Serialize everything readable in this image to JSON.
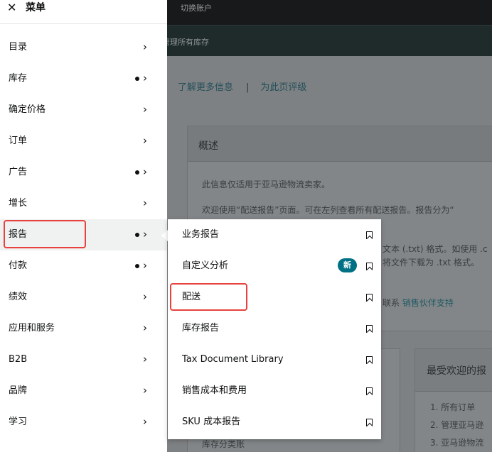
{
  "background": {
    "topbar_text": "切换账户",
    "subbar_text": "管理所有库存",
    "links": {
      "learn_more": "了解更多信息",
      "rate_page": "为此页评级"
    },
    "overview": {
      "title": "概述",
      "line1": "此信息仅适用于亚马逊物流卖家。",
      "line2": "欢迎使用“配送报告”页面。可在左列查看所有配送报告。报告分为“",
      "line3": "文本 (.txt) 格式。如使用 .c",
      "line4": "将文件下载为 .txt 格式。",
      "contact_prefix": "联系",
      "contact_link": "销售伙伴支持"
    },
    "popular": {
      "title": "最受欢迎的报",
      "items": [
        "1. 所有订单",
        "2. 管理亚马逊",
        "3. 亚马逊物流"
      ]
    },
    "inventory_ledger": "库存分类账"
  },
  "menu": {
    "title": "菜单",
    "close_icon": "close-icon",
    "items": [
      {
        "label": "目录",
        "dot": false
      },
      {
        "label": "库存",
        "dot": true
      },
      {
        "label": "确定价格",
        "dot": false
      },
      {
        "label": "订单",
        "dot": false
      },
      {
        "label": "广告",
        "dot": true
      },
      {
        "label": "增长",
        "dot": false
      },
      {
        "label": "报告",
        "dot": true,
        "active": true
      },
      {
        "label": "付款",
        "dot": true
      },
      {
        "label": "绩效",
        "dot": false
      },
      {
        "label": "应用和服务",
        "dot": false
      },
      {
        "label": "B2B",
        "dot": false
      },
      {
        "label": "品牌",
        "dot": false
      },
      {
        "label": "学习",
        "dot": false
      }
    ],
    "chevron": "›"
  },
  "submenu": {
    "items": [
      {
        "label": "业务报告"
      },
      {
        "label": "自定义分析",
        "badge": "新"
      },
      {
        "label": "配送"
      },
      {
        "label": "库存报告"
      },
      {
        "label": "Tax Document Library"
      },
      {
        "label": "销售成本和费用"
      },
      {
        "label": "SKU 成本报告"
      }
    ]
  },
  "colors": {
    "highlight": "#e8423f",
    "badge": "#007185"
  }
}
